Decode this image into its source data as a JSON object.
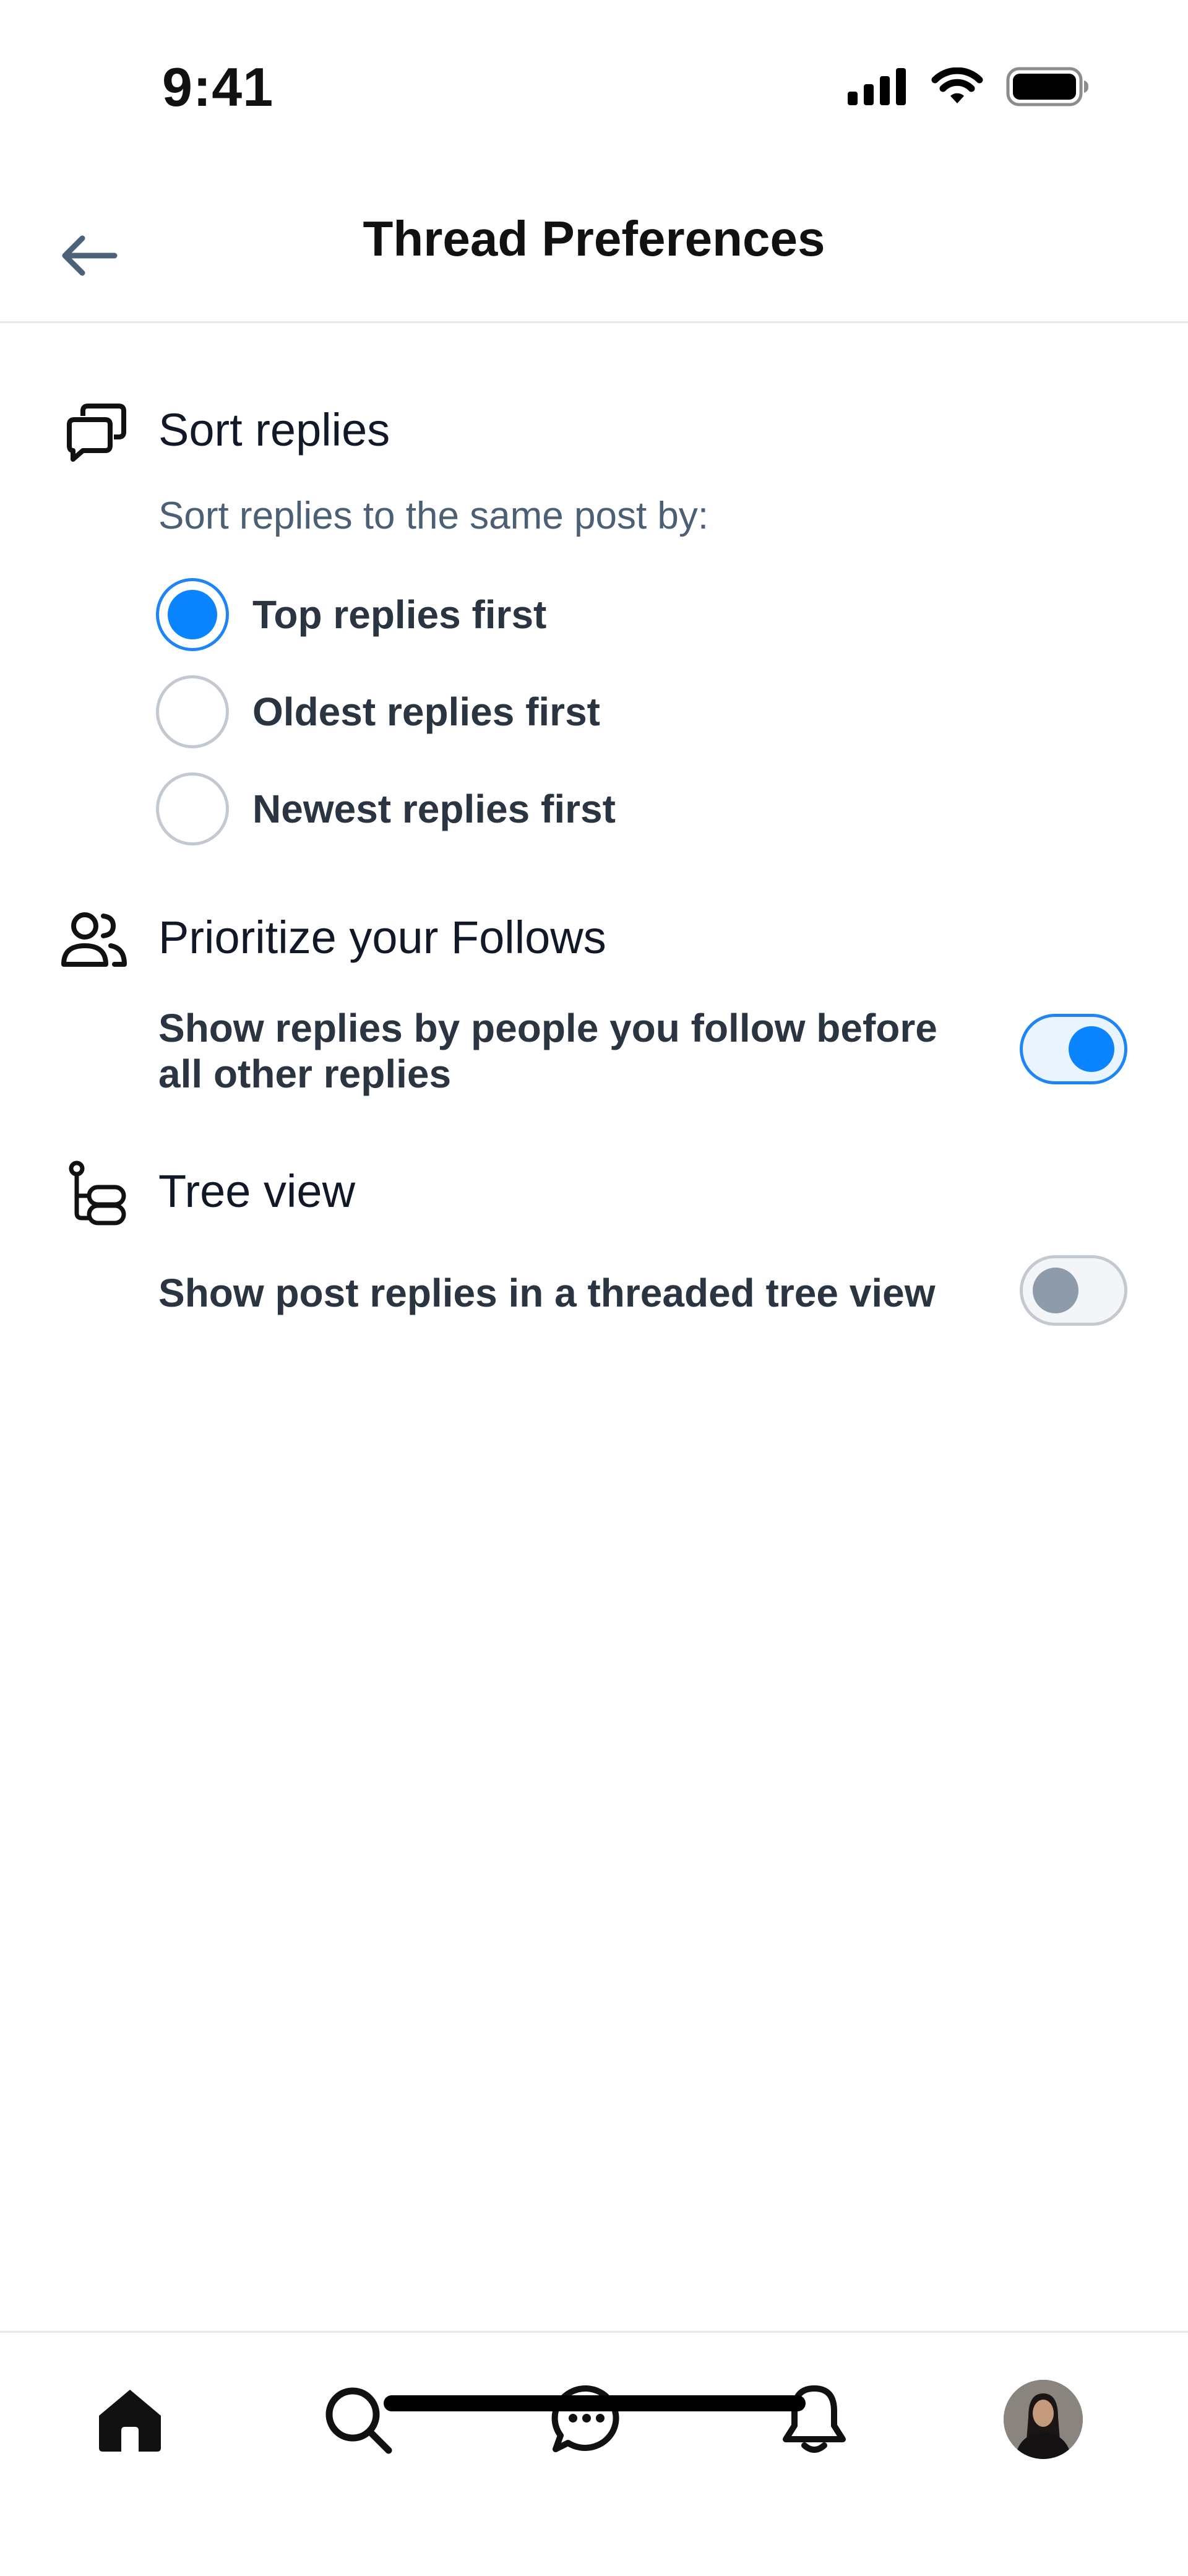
{
  "status_bar": {
    "time": "9:41"
  },
  "header": {
    "title": "Thread Preferences"
  },
  "sort_section": {
    "title": "Sort replies",
    "subtitle": "Sort replies to the same post by:",
    "options": [
      {
        "label": "Top replies first",
        "selected": true
      },
      {
        "label": "Oldest replies first",
        "selected": false
      },
      {
        "label": "Newest replies first",
        "selected": false
      }
    ]
  },
  "follows_section": {
    "title": "Prioritize your Follows",
    "setting_label": "Show replies by people you follow before all other replies",
    "enabled": true
  },
  "tree_section": {
    "title": "Tree view",
    "setting_label": "Show post replies in a threaded tree view",
    "enabled": false
  },
  "bottom_nav": {
    "items": [
      "home-icon",
      "search-icon",
      "chat-icon",
      "bell-icon",
      "profile-avatar"
    ]
  },
  "colors": {
    "accent": "#0a84ff",
    "text_primary": "#111827",
    "text_secondary": "#4b5f75"
  }
}
